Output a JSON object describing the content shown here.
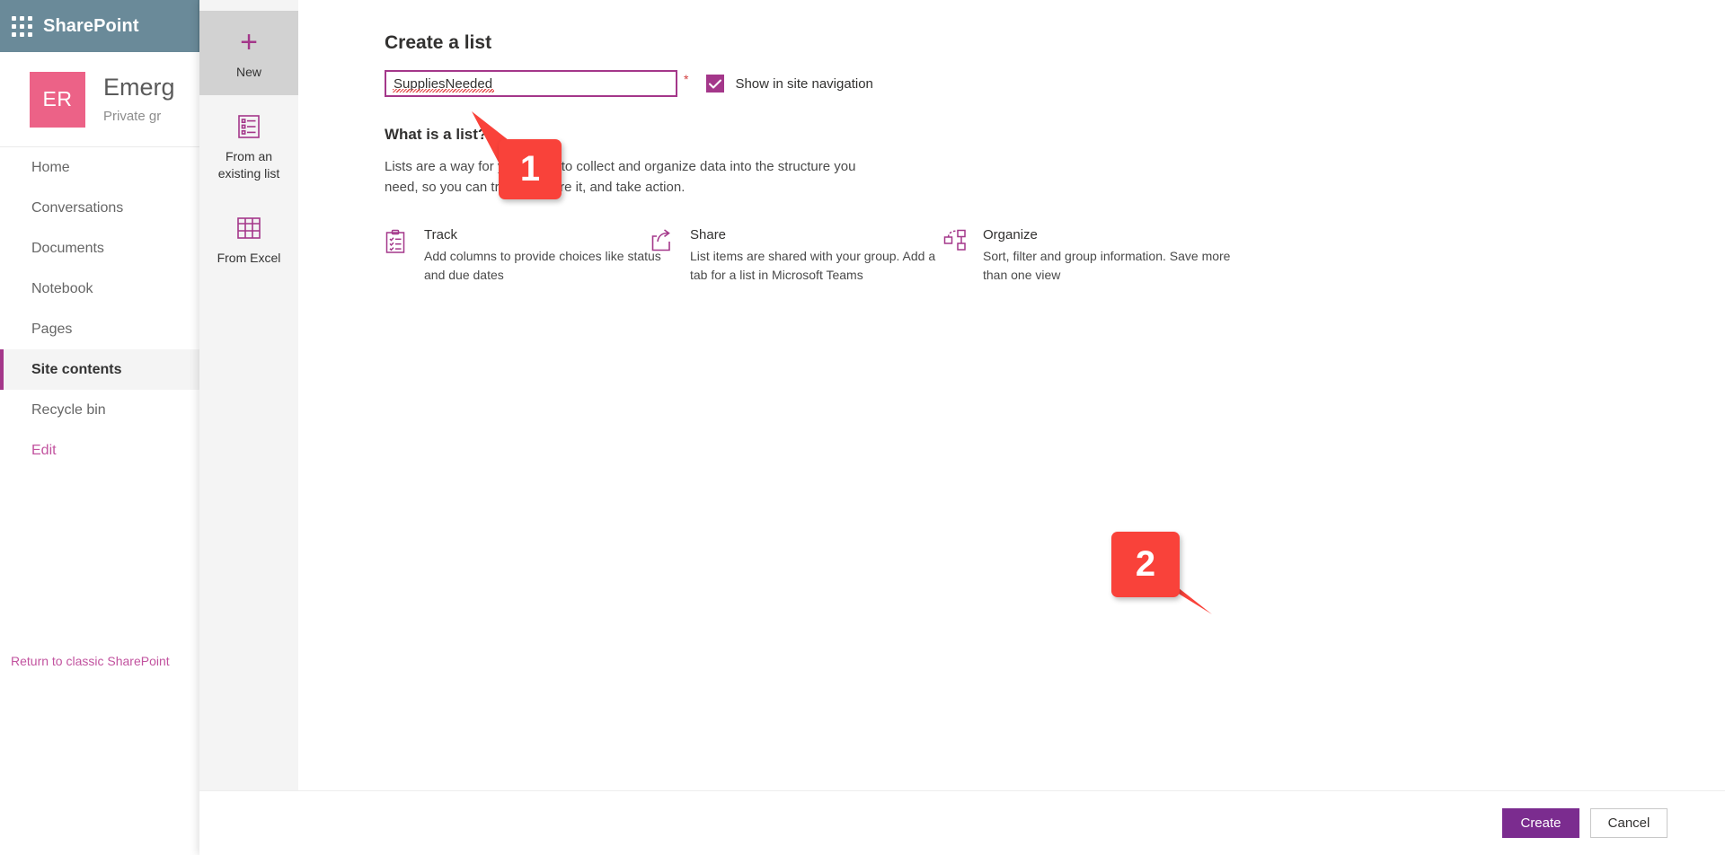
{
  "suite": {
    "waffle_icon": "app-launcher-icon",
    "title": "SharePoint"
  },
  "site": {
    "avatar_initials": "ER",
    "name": "Emerg",
    "subtitle": "Private gr"
  },
  "sidebar": {
    "items": [
      {
        "label": "Home",
        "selected": false
      },
      {
        "label": "Conversations",
        "selected": false
      },
      {
        "label": "Documents",
        "selected": false
      },
      {
        "label": "Notebook",
        "selected": false
      },
      {
        "label": "Pages",
        "selected": false
      },
      {
        "label": "Site contents",
        "selected": true
      },
      {
        "label": "Recycle bin",
        "selected": false
      },
      {
        "label": "Edit",
        "selected": false
      }
    ],
    "return_classic": "Return to classic SharePoint"
  },
  "dialog": {
    "title": "Create a list",
    "rail": [
      {
        "label": "New",
        "icon": "plus-icon",
        "active": true
      },
      {
        "label": "From an existing list",
        "icon": "list-icon",
        "active": false
      },
      {
        "label": "From Excel",
        "icon": "excel-grid-icon",
        "active": false
      }
    ],
    "name_field": {
      "value": "SuppliesNeeded",
      "placeholder": "Name",
      "required_marker": "*"
    },
    "checkbox": {
      "label": "Show in site navigation",
      "checked": true,
      "icon": "checkmark-icon"
    },
    "info": {
      "heading": "What is a list?",
      "description": "Lists are a way for your team to collect and organize data into the structure you need, so you can track it, share it, and take action."
    },
    "features": [
      {
        "icon": "clipboard-list-icon",
        "title": "Track",
        "description": "Add columns to provide choices like status and due dates"
      },
      {
        "icon": "share-icon",
        "title": "Share",
        "description": "List items are shared with your group. Add a tab for a list in Microsoft Teams"
      },
      {
        "icon": "organize-icon",
        "title": "Organize",
        "description": "Sort, filter and group information. Save more than one view"
      }
    ],
    "footer": {
      "create_label": "Create",
      "cancel_label": "Cancel"
    }
  },
  "annotations": [
    {
      "number": "1"
    },
    {
      "number": "2"
    }
  ],
  "colors": {
    "suite_bar": "#6a8a99",
    "accent_purple": "#a4378a",
    "primary_button": "#7b2c8f",
    "avatar_pink": "#ec6287",
    "callout_red": "#f9423a",
    "required_red": "#d23f3f"
  }
}
